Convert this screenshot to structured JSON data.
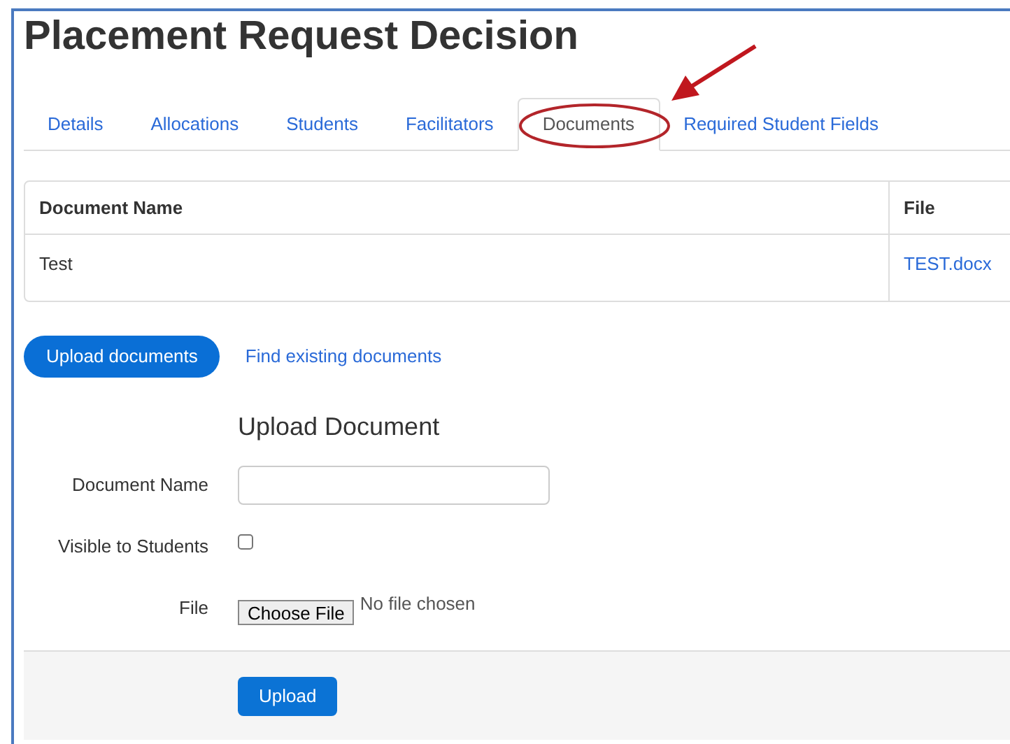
{
  "page": {
    "title": "Placement Request Decision"
  },
  "tabs": [
    {
      "label": "Details",
      "selected": false
    },
    {
      "label": "Allocations",
      "selected": false
    },
    {
      "label": "Students",
      "selected": false
    },
    {
      "label": "Facilitators",
      "selected": false
    },
    {
      "label": "Documents",
      "selected": true,
      "highlighted": true
    },
    {
      "label": "Required Student Fields",
      "selected": false
    }
  ],
  "table": {
    "columns": [
      "Document Name",
      "File"
    ],
    "rows": [
      {
        "cells": [
          "Test",
          "TEST.docx"
        ]
      }
    ]
  },
  "pills": [
    {
      "label": "Upload documents",
      "selected": true
    },
    {
      "label": "Find existing documents",
      "selected": false
    }
  ],
  "form": {
    "heading": "Upload Document",
    "fields": [
      {
        "kind": "text",
        "label": "Document Name"
      },
      {
        "kind": "checkbox",
        "label": "Visible to Students",
        "checked": false
      },
      {
        "kind": "file",
        "label": "File",
        "button": "Choose File",
        "status": "No file chosen"
      }
    ],
    "submit": "Upload"
  }
}
